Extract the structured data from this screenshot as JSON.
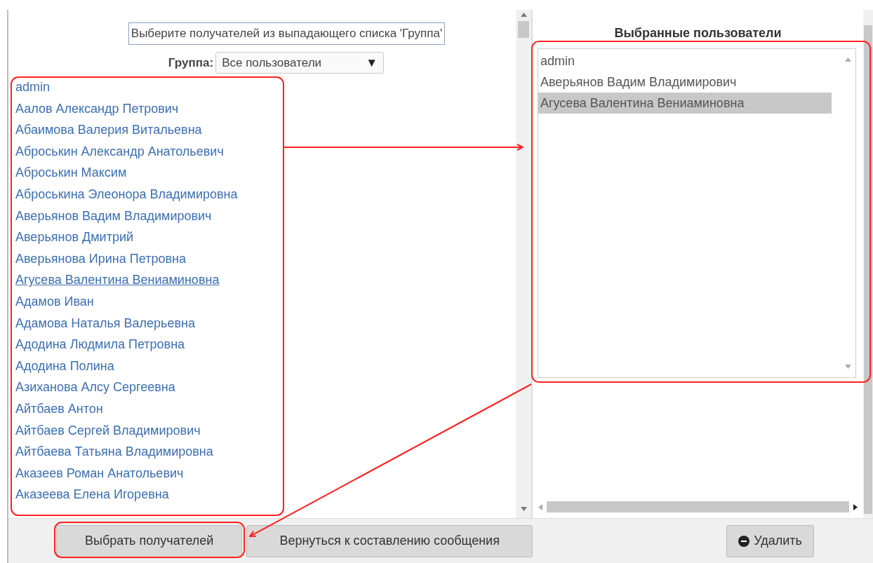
{
  "left_panel": {
    "instruction": "Выберите получателей из выпадающего списка 'Группа'",
    "group_label": "Группа:",
    "group_select": {
      "value": "Все пользователи",
      "arrow": "▼"
    },
    "users": [
      {
        "name": "admin",
        "hovered": false
      },
      {
        "name": "Аалов Александр Петрович",
        "hovered": false
      },
      {
        "name": "Абаимова Валерия Витальевна",
        "hovered": false
      },
      {
        "name": "Аброськин Александр Анатольевич",
        "hovered": false
      },
      {
        "name": "Аброськин Максим",
        "hovered": false
      },
      {
        "name": "Аброськина Элеонора Владимировна",
        "hovered": false
      },
      {
        "name": "Аверьянов Вадим Владимирович",
        "hovered": false
      },
      {
        "name": "Аверьянов Дмитрий",
        "hovered": false
      },
      {
        "name": "Аверьянова Ирина Петровна",
        "hovered": false
      },
      {
        "name": "Агусева Валентина Вениаминовна",
        "hovered": true
      },
      {
        "name": "Адамов Иван",
        "hovered": false
      },
      {
        "name": "Адамова Наталья Валерьевна",
        "hovered": false
      },
      {
        "name": "Адодина Людмила Петровна",
        "hovered": false
      },
      {
        "name": "Адодина Полина",
        "hovered": false
      },
      {
        "name": "Азиханова Алсу Сергеевна",
        "hovered": false
      },
      {
        "name": "Айтбаев Антон",
        "hovered": false
      },
      {
        "name": "Айтбаев Сергей Владимирович",
        "hovered": false
      },
      {
        "name": "Айтбаева Татьяна Владимировна",
        "hovered": false
      },
      {
        "name": "Аказеев Роман Анатольевич",
        "hovered": false
      },
      {
        "name": "Аказеева Елена Игоревна",
        "hovered": false
      }
    ]
  },
  "right_panel": {
    "title": "Выбранные пользователи",
    "selected_users": [
      {
        "name": "admin",
        "selected": false
      },
      {
        "name": "Аверьянов Вадим Владимирович",
        "selected": false
      },
      {
        "name": "Агусева Валентина Вениаминовна",
        "selected": true
      }
    ]
  },
  "buttons": [
    {
      "kind": "plain",
      "label": "Выбрать получателей"
    },
    {
      "kind": "plain",
      "label": "Вернуться к составлению сообщения"
    },
    {
      "kind": "delete",
      "label": "Удалить"
    }
  ]
}
